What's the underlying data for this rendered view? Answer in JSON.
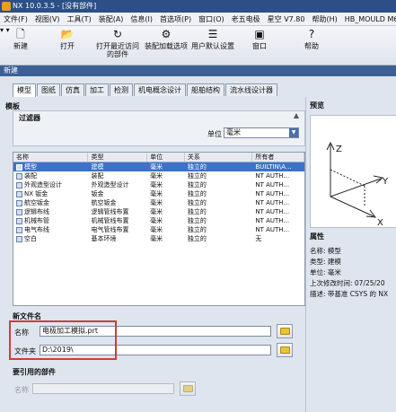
{
  "window": {
    "title": "NX 10.0.3.5 - [没有部件]"
  },
  "menu": [
    "文件(F)",
    "视图(V)",
    "工具(T)",
    "装配(A)",
    "信息(I)",
    "首选项(P)",
    "窗口(O)",
    "老五电极",
    "星空 V7.80",
    "帮助(H)",
    "HB_MOULD M6.6"
  ],
  "toolbar": {
    "new": "新建",
    "open": "打开",
    "open_recent": "打开最近访问的部件",
    "assembly_load": "装配加载选项",
    "user_defaults": "用户默认设置",
    "window": "窗口",
    "help": "帮助"
  },
  "dialog": {
    "title": "新建",
    "tabs": [
      "模型",
      "图纸",
      "仿真",
      "加工",
      "检测",
      "机电概念设计",
      "船舶结构",
      "流水线设计器"
    ],
    "templates_header": "模板",
    "filter": {
      "title": "过滤器",
      "unit_label": "单位",
      "unit_value": "毫米"
    },
    "columns": [
      "名称",
      "类型",
      "单位",
      "关系",
      "所有者"
    ],
    "rows": [
      [
        "模型",
        "建模",
        "毫米",
        "独立的",
        "BUILTIN\\A..."
      ],
      [
        "装配",
        "装配",
        "毫米",
        "独立的",
        "NT AUTH..."
      ],
      [
        "外观造型设计",
        "外观造型设计",
        "毫米",
        "独立的",
        "NT AUTH..."
      ],
      [
        "NX 钣金",
        "钣金",
        "毫米",
        "独立的",
        "NT AUTH..."
      ],
      [
        "航空钣金",
        "航空钣金",
        "毫米",
        "独立的",
        "NT AUTH..."
      ],
      [
        "逻辑布线",
        "逻辑管线布置",
        "毫米",
        "独立的",
        "NT AUTH..."
      ],
      [
        "机械布管",
        "机械管线布置",
        "毫米",
        "独立的",
        "NT AUTH..."
      ],
      [
        "电气布线",
        "电气管线布置",
        "毫米",
        "独立的",
        "NT AUTH..."
      ],
      [
        "空白",
        "基本环境",
        "毫米",
        "独立的",
        "无"
      ]
    ],
    "new_file_header": "新文件名",
    "name_label": "名称",
    "name_value": "电极加工模拟.prt",
    "folder_label": "文件夹",
    "folder_value": "D:\\2019\\",
    "ref_header": "要引用的部件",
    "ref_name_label": "名称"
  },
  "preview": {
    "header": "预览",
    "properties_header": "属性",
    "props": [
      "名称: 模型",
      "类型: 建模",
      "单位: 毫米",
      "上次修改时间: 07/25/20",
      "描述: 带基准 CSYS 的 NX"
    ]
  },
  "colors": {
    "selection": "#3d72c8",
    "highlight_box": "#d23b3b",
    "dialog_bar": "#3c5f95"
  }
}
